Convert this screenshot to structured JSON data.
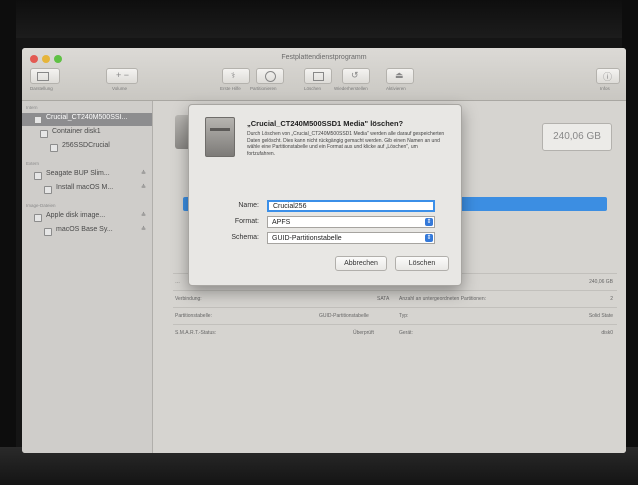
{
  "window_title": "Festplattendienstprogramm",
  "toolbar": {
    "view_label": "Darstellung",
    "volume_label": "Volume",
    "actions": [
      "Erste Hilfe",
      "Partitionieren",
      "Löschen",
      "Wiederherstellen",
      "Aktivieren"
    ],
    "info_label": "Infos"
  },
  "sidebar": {
    "section_intern": "Intern",
    "section_extern": "Extern",
    "section_images": "Image-Dateien",
    "items": [
      {
        "label": "Crucial_CT240M500SSI...",
        "eject": ""
      },
      {
        "label": "Container disk1",
        "eject": ""
      },
      {
        "label": "256SSDCrucial",
        "eject": ""
      },
      {
        "label": "Seagate BUP Slim...",
        "eject": "≜"
      },
      {
        "label": "Install macOS M...",
        "eject": "≜"
      },
      {
        "label": "Apple disk image...",
        "eject": "≜"
      },
      {
        "label": "macOS Base Sy...",
        "eject": "≜"
      }
    ]
  },
  "main": {
    "capacity": "240,06 GB",
    "rows": [
      {
        "left_label": "Verbindung:",
        "left_value": "SATA",
        "right_label": "Anzahl an untergeordneten Partitionen:",
        "right_value": "2"
      },
      {
        "left_label": "Partitionstabelle:",
        "left_value": "GUID-Partitionstabelle",
        "right_label": "Typ:",
        "right_value": "Solid State"
      },
      {
        "left_label": "S.M.A.R.T.-Status:",
        "left_value": "Überprüft",
        "right_label": "Gerät:",
        "right_value": "disk0"
      }
    ],
    "capacity_small": "240,06 GB"
  },
  "dialog": {
    "title": "„Crucial_CT240M500SSD1 Media\" löschen?",
    "body": "Durch Löschen von „Crucial_CT240M500SSD1 Media\" werden alle darauf gespeicherten Daten gelöscht. Dies kann nicht rückgängig gemacht werden. Gib einen Namen an und wähle eine Partitionstabelle und ein Format aus und klicke auf „Löschen\", um fortzufahren.",
    "name_label": "Name:",
    "name_value": "Crucial256",
    "format_label": "Format:",
    "format_value": "APFS",
    "scheme_label": "Schema:",
    "scheme_value": "GUID-Partitionstabelle",
    "cancel_label": "Abbrechen",
    "erase_label": "Löschen"
  },
  "colors": {
    "accent": "#3b8fe8",
    "close": "#e35a52",
    "minimize": "#e6b53a",
    "zoom": "#5fc144"
  }
}
